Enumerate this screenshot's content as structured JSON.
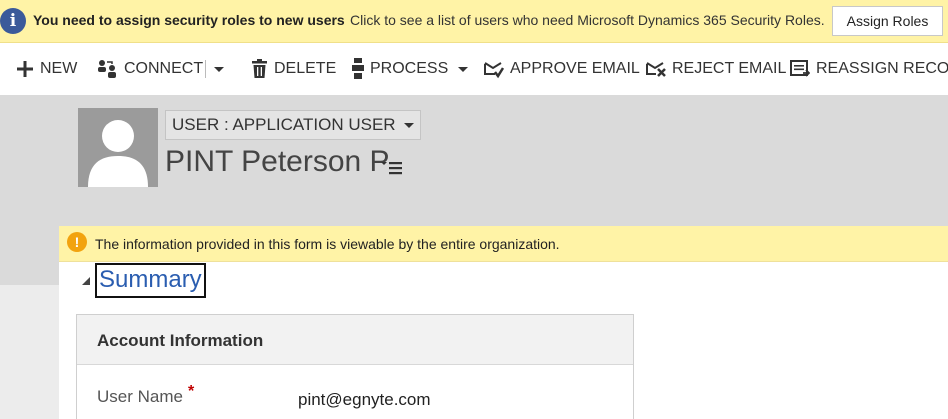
{
  "notification": {
    "title": "You need to assign security roles to new users",
    "link_text": "Click to see a list of users who need Microsoft Dynamics 365 Security Roles.",
    "button_label": "Assign Roles",
    "icon": "info-icon"
  },
  "command_bar": {
    "new_label": "NEW",
    "connect_label": "CONNECT",
    "delete_label": "DELETE",
    "process_label": "PROCESS",
    "approve_email_label": "APPROVE EMAIL",
    "reject_email_label": "REJECT EMAIL",
    "reassign_records_label": "REASSIGN RECORDS"
  },
  "header": {
    "form_selector_label": "USER : APPLICATION USER",
    "record_name": "PINT Peterson P"
  },
  "warning": {
    "text": "The information provided in this form is viewable by the entire organization.",
    "icon": "warning-icon"
  },
  "section": {
    "title": "Summary"
  },
  "card": {
    "title": "Account Information",
    "fields": [
      {
        "label": "User Name",
        "required_marker": "*",
        "value": "pint@egnyte.com"
      }
    ]
  },
  "colors": {
    "notice_background": "#fff3a6",
    "info_icon": "#3b5a9a",
    "warning_icon": "#f2a30f",
    "header_background": "#dadada",
    "section_title": "#2a5db0",
    "required": "#c00000"
  }
}
